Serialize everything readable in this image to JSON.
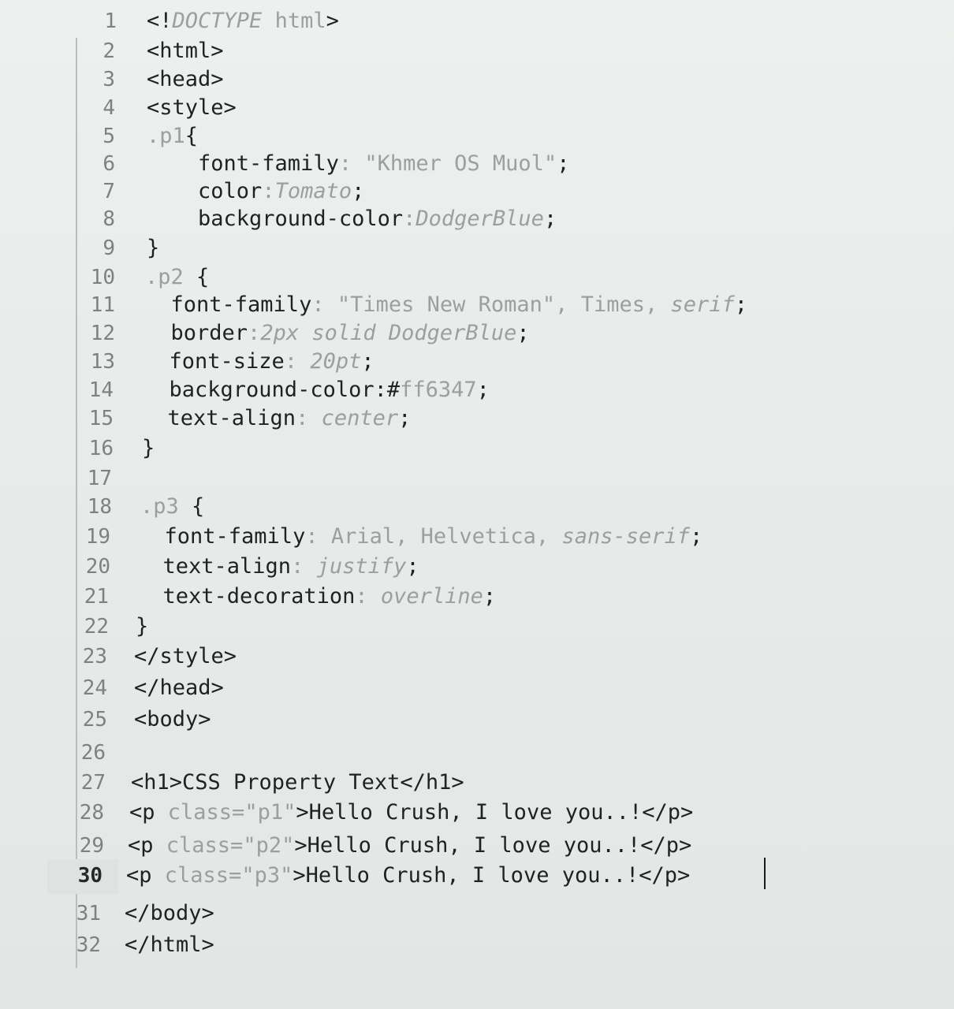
{
  "editor": {
    "lines": [
      {
        "n": "1",
        "parts": [
          {
            "t": "<!",
            "c": ""
          },
          {
            "t": "DOCTYPE",
            "c": "gray ital"
          },
          {
            "t": " html",
            "c": "gray"
          },
          {
            "t": ">",
            "c": ""
          }
        ]
      },
      {
        "n": "2",
        "parts": [
          {
            "t": "<html>",
            "c": ""
          }
        ]
      },
      {
        "n": "3",
        "parts": [
          {
            "t": "<head>",
            "c": ""
          }
        ]
      },
      {
        "n": "4",
        "parts": [
          {
            "t": "<style>",
            "c": ""
          }
        ]
      },
      {
        "n": "5",
        "parts": [
          {
            "t": ".p1",
            "c": "gray"
          },
          {
            "t": "{",
            "c": ""
          }
        ]
      },
      {
        "n": "6",
        "parts": [
          {
            "t": "    font-family",
            "c": ""
          },
          {
            "t": ": \"Khmer OS Muol\"",
            "c": "gray"
          },
          {
            "t": ";",
            "c": ""
          }
        ]
      },
      {
        "n": "7",
        "parts": [
          {
            "t": "    color",
            "c": ""
          },
          {
            "t": ":",
            "c": "gray"
          },
          {
            "t": "Tomato",
            "c": "gray ital"
          },
          {
            "t": ";",
            "c": ""
          }
        ]
      },
      {
        "n": "8",
        "parts": [
          {
            "t": "    background-color",
            "c": ""
          },
          {
            "t": ":",
            "c": "gray"
          },
          {
            "t": "DodgerBlue",
            "c": "gray ital"
          },
          {
            "t": ";",
            "c": ""
          }
        ]
      },
      {
        "n": "9",
        "parts": [
          {
            "t": "}",
            "c": ""
          }
        ]
      },
      {
        "n": "10",
        "parts": [
          {
            "t": ".p2",
            "c": "gray"
          },
          {
            "t": " {",
            "c": ""
          }
        ]
      },
      {
        "n": "11",
        "parts": [
          {
            "t": "  font-family",
            "c": ""
          },
          {
            "t": ": \"Times New Roman\", Times, ",
            "c": "gray"
          },
          {
            "t": "serif",
            "c": "gray ital"
          },
          {
            "t": ";",
            "c": ""
          }
        ]
      },
      {
        "n": "12",
        "parts": [
          {
            "t": "  border",
            "c": ""
          },
          {
            "t": ":",
            "c": "gray"
          },
          {
            "t": "2px solid DodgerBlue",
            "c": "gray ital"
          },
          {
            "t": ";",
            "c": ""
          }
        ]
      },
      {
        "n": "13",
        "parts": [
          {
            "t": "  font-size",
            "c": ""
          },
          {
            "t": ": ",
            "c": "gray"
          },
          {
            "t": "20pt",
            "c": "gray ital"
          },
          {
            "t": ";",
            "c": ""
          }
        ]
      },
      {
        "n": "14",
        "parts": [
          {
            "t": "  background-color",
            "c": ""
          },
          {
            "t": ":#",
            "c": ""
          },
          {
            "t": "ff6347",
            "c": "gray"
          },
          {
            "t": ";",
            "c": ""
          }
        ]
      },
      {
        "n": "15",
        "parts": [
          {
            "t": "  text-align",
            "c": ""
          },
          {
            "t": ": ",
            "c": "gray"
          },
          {
            "t": "center",
            "c": "gray ital"
          },
          {
            "t": ";",
            "c": ""
          }
        ]
      },
      {
        "n": "16",
        "parts": [
          {
            "t": "}",
            "c": ""
          }
        ]
      },
      {
        "n": "17",
        "parts": []
      },
      {
        "n": "18",
        "parts": [
          {
            "t": ".p3",
            "c": "gray"
          },
          {
            "t": " {",
            "c": ""
          }
        ]
      },
      {
        "n": "19",
        "parts": [
          {
            "t": "  font-family",
            "c": ""
          },
          {
            "t": ": Arial, Helvetica, ",
            "c": "gray"
          },
          {
            "t": "sans-serif",
            "c": "gray ital"
          },
          {
            "t": ";",
            "c": ""
          }
        ]
      },
      {
        "n": "20",
        "parts": [
          {
            "t": "  text-align",
            "c": ""
          },
          {
            "t": ": ",
            "c": "gray"
          },
          {
            "t": "justify",
            "c": "gray ital"
          },
          {
            "t": ";",
            "c": ""
          }
        ]
      },
      {
        "n": "21",
        "parts": [
          {
            "t": "  text-decoration",
            "c": ""
          },
          {
            "t": ": ",
            "c": "gray"
          },
          {
            "t": "overline",
            "c": "gray ital"
          },
          {
            "t": ";",
            "c": ""
          }
        ]
      },
      {
        "n": "22",
        "parts": [
          {
            "t": "}",
            "c": ""
          }
        ]
      },
      {
        "n": "23",
        "parts": [
          {
            "t": "</style>",
            "c": ""
          }
        ]
      },
      {
        "n": "24",
        "parts": [
          {
            "t": "</head>",
            "c": ""
          }
        ]
      },
      {
        "n": "25",
        "parts": [
          {
            "t": "<body>",
            "c": ""
          }
        ]
      },
      {
        "n": "26",
        "parts": []
      },
      {
        "n": "27",
        "parts": [
          {
            "t": "<h1>CSS Property Text</h1>",
            "c": ""
          }
        ]
      },
      {
        "n": "28",
        "parts": [
          {
            "t": "<p ",
            "c": ""
          },
          {
            "t": "class=\"p1\"",
            "c": "gray"
          },
          {
            "t": ">Hello Crush, I love you..!</p>",
            "c": ""
          }
        ]
      },
      {
        "n": "29",
        "parts": [
          {
            "t": "<p ",
            "c": ""
          },
          {
            "t": "class=\"p2\"",
            "c": "gray"
          },
          {
            "t": ">Hello Crush, I love you..!</p>",
            "c": ""
          }
        ]
      },
      {
        "n": "30",
        "parts": [
          {
            "t": "<p ",
            "c": ""
          },
          {
            "t": "class=\"p3\"",
            "c": "gray"
          },
          {
            "t": ">Hello Crush, I love you..!</p>",
            "c": ""
          }
        ]
      },
      {
        "n": "31",
        "parts": [
          {
            "t": "</body>",
            "c": ""
          }
        ]
      },
      {
        "n": "32",
        "parts": [
          {
            "t": "</html>",
            "c": ""
          }
        ]
      }
    ],
    "active_line": "30"
  }
}
